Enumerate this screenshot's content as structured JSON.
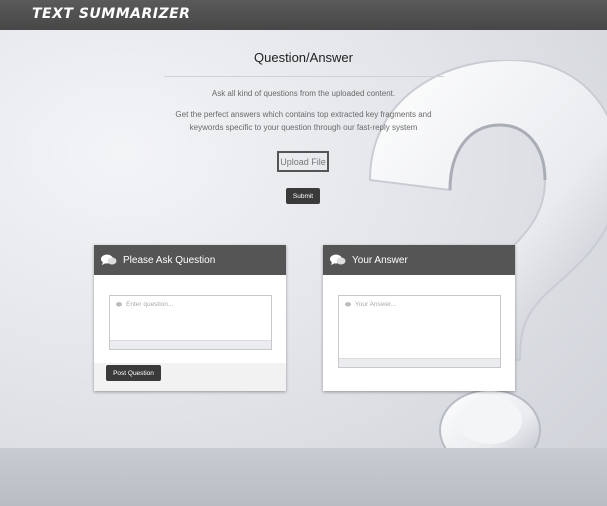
{
  "header": {
    "brand": "TEXT SUMMARIZER"
  },
  "main": {
    "title": "Question/Answer",
    "description_1": "Ask all kind of questions from the uploaded content.",
    "description_2a": "Get the perfect answers which contains top extracted key fragments and",
    "description_2b": "keywords specific to your question through our fast-reply system",
    "upload_label": "Upload File",
    "submit_label": "Submit"
  },
  "question_panel": {
    "title": "Please Ask Question",
    "placeholder": "Enter question...",
    "button_label": "Post Question",
    "icon": "chat-bubbles-icon"
  },
  "answer_panel": {
    "title": "Your Answer",
    "placeholder": "Your Answer...",
    "icon": "chat-bubbles-icon"
  },
  "colors": {
    "header_bg": "#4f4f4f",
    "panel_header_bg": "#555555",
    "button_bg": "#3a3a3a"
  }
}
